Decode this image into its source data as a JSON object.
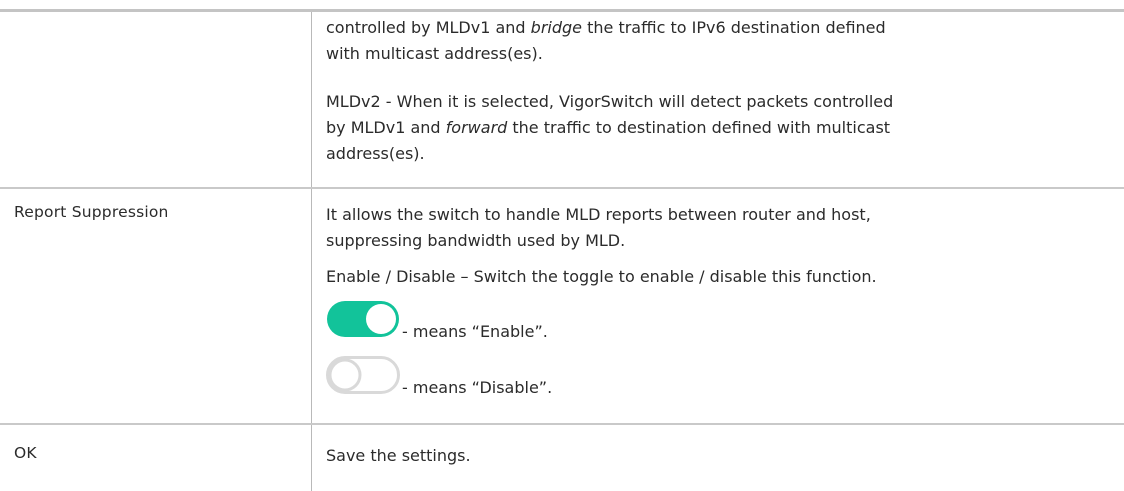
{
  "intro": {
    "line1_pre": "controlled by MLDv1 and ",
    "line1_em": "bridge",
    "line1_post": " the traffic to IPv6 destination defined",
    "line2": "with multicast address(es).",
    "mldv2_line1": "MLDv2 - When it is selected, VigorSwitch will detect packets controlled",
    "mldv2_line2_pre": "by MLDv1 and ",
    "mldv2_line2_em": "forward",
    "mldv2_line2_post": " the traffic to destination defined with multicast",
    "mldv2_line3": "address(es)."
  },
  "rows": {
    "report_suppression": {
      "label": "Report Suppression",
      "desc_line1": "It allows the switch to handle MLD reports between router and host,",
      "desc_line2": "suppressing bandwidth used by MLD.",
      "toggle_line": "Enable / Disable – Switch the toggle to enable / disable this function.",
      "enable_text": "- means “Enable”.",
      "disable_text": "- means “Disable”."
    },
    "ok": {
      "label": "OK",
      "desc": "Save the settings."
    }
  },
  "colors": {
    "toggle_on": "#12c39a",
    "toggle_off_border": "#d9d9d9",
    "rule": "#c4c4c4"
  },
  "icons": {
    "enable": "toggle-on-icon",
    "disable": "toggle-off-icon"
  }
}
